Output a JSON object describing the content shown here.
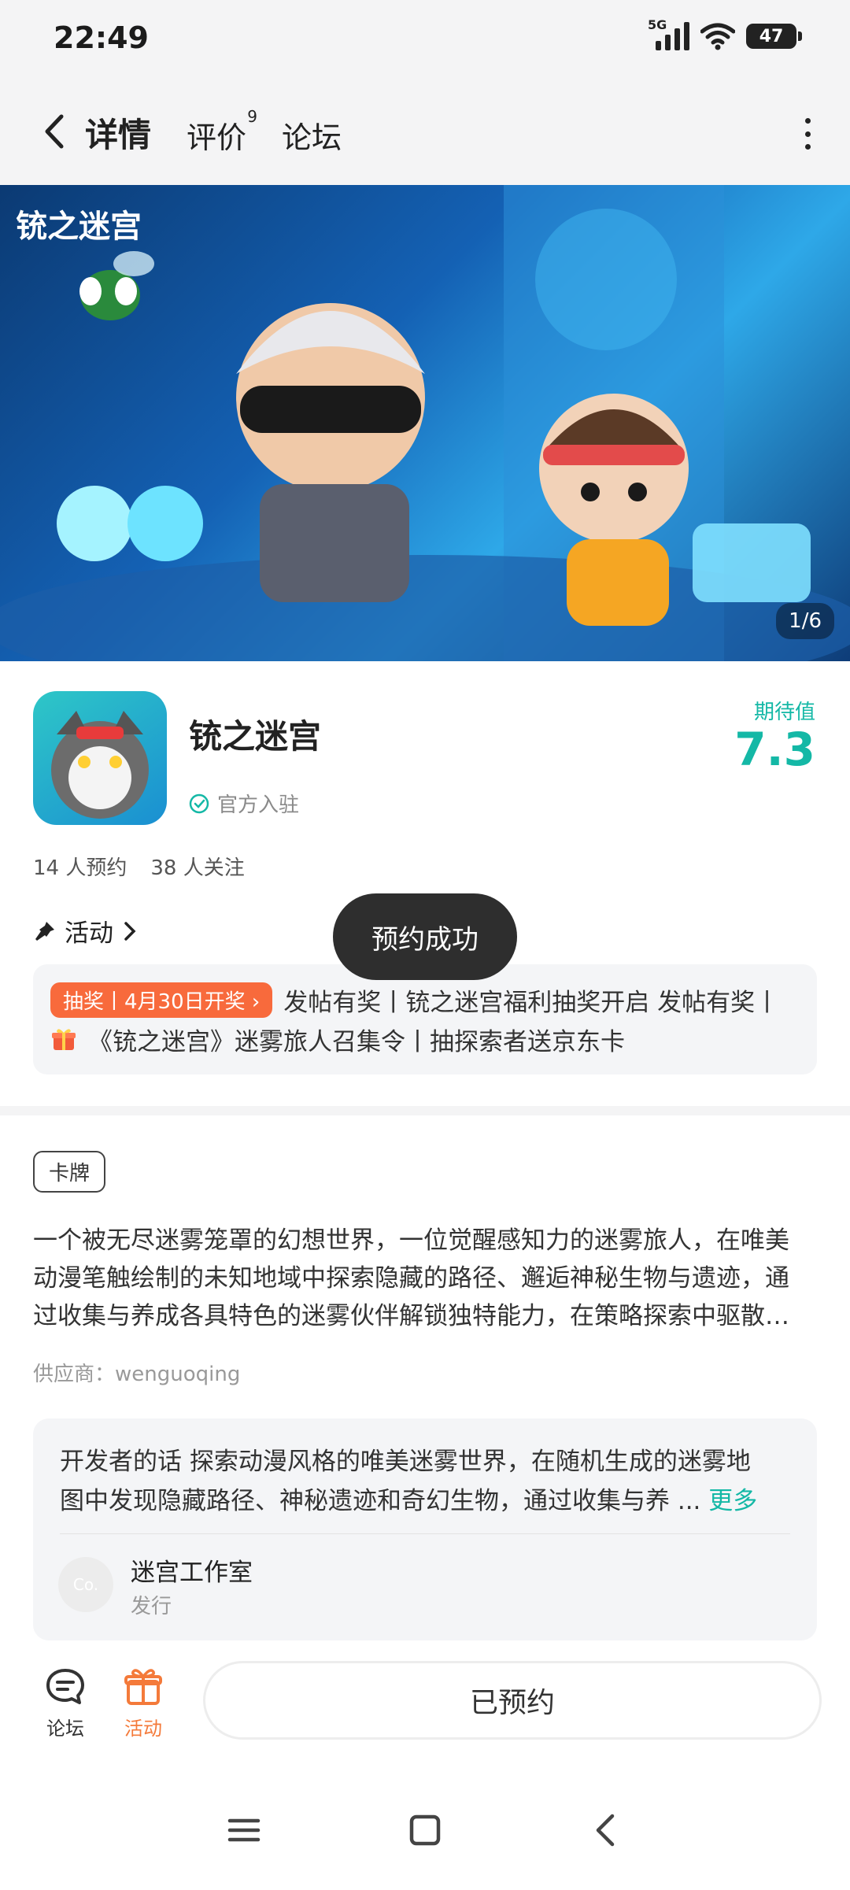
{
  "status_bar": {
    "time": "22:49",
    "network": "5G",
    "battery": "47"
  },
  "header": {
    "tabs": [
      {
        "label": "详情",
        "active": true
      },
      {
        "label": "评价",
        "badge": "9"
      },
      {
        "label": "论坛"
      }
    ]
  },
  "hero": {
    "title": "铳之迷宫",
    "counter": "1/6"
  },
  "app": {
    "name": "铳之迷宫",
    "verified_label": "官方入驻",
    "rating_label": "期待值",
    "rating_value": "7.3",
    "reservations": "14 人预约",
    "followers": "38 人关注"
  },
  "activity": {
    "label": "活动",
    "promo_tag": "抽奖丨4月30日开奖 ›",
    "promo_line1": "发帖有奖丨铳之迷宫福利抽奖开启 发帖有奖丨",
    "promo_line2": "《铳之迷宫》迷雾旅人召集令丨抽探索者送京东卡"
  },
  "toast": {
    "text": "预约成功"
  },
  "details": {
    "tag": "卡牌",
    "description_lines": [
      "一个被无尽迷雾笼罩的幻想世界，一位觉醒感知力的迷雾旅人，在唯美",
      "动漫笔触绘制的未知地域中探索隐藏的路径、邂逅神秘生物与遗迹，通",
      "过收集与养成各具特色的迷雾伙伴解锁独特能力，在策略探索中驱散…"
    ],
    "supplier": "供应商：wenguoqing"
  },
  "developer": {
    "label": "开发者的话",
    "text_line1": "探索动漫风格的唯美迷雾世界，在随机生成的迷雾地",
    "text_line2": "图中发现隐藏路径、神秘遗迹和奇幻生物，通过收集与养 ...",
    "more": "更多",
    "avatar_text": "Co.",
    "studio": "迷宫工作室",
    "role": "发行"
  },
  "bottom_bar": {
    "forum": "论坛",
    "activity": "活动",
    "reserved": "已预约"
  },
  "colors": {
    "accent": "#14b8a6",
    "orange": "#f47a3a",
    "promo_tag": "#f86a3c"
  }
}
